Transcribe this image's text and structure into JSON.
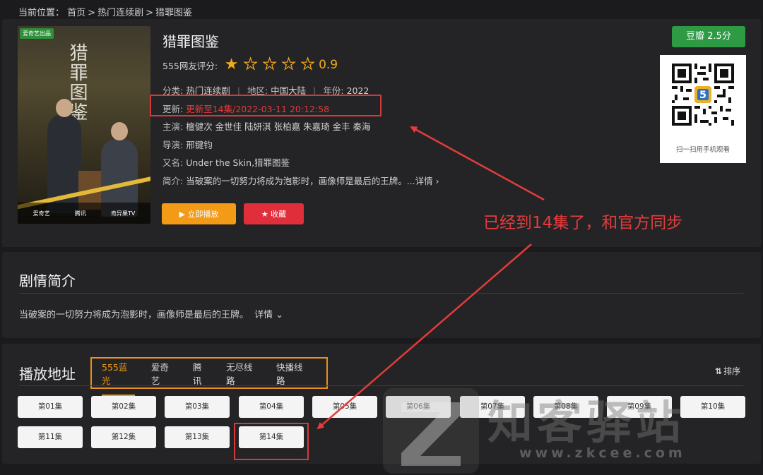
{
  "breadcrumb": {
    "prefix": "当前位置：",
    "home": "首页",
    "category": "热门连续剧",
    "current": "猎罪图鉴",
    "sep": ">"
  },
  "poster": {
    "badge": "爱奇艺出品",
    "art_title": "猎罪图鉴",
    "logos": [
      "爱奇艺",
      "腾讯",
      "奇异果TV"
    ]
  },
  "show": {
    "title": "猎罪图鉴",
    "rating_label": "555网友评分:",
    "rating_value": "0.9",
    "rating_stars": 1,
    "category_label": "分类:",
    "category": "热门连续剧",
    "region_label": "地区:",
    "region": "中国大陆",
    "year_label": "年份:",
    "year": "2022",
    "update_label": "更新:",
    "update": "更新至14集/2022-03-11 20:12:58",
    "cast_label": "主演:",
    "cast": "檀健次 金世佳 陆妍淇 张柏嘉 朱嘉琦 金丰 秦海",
    "director_label": "导演:",
    "director": "邢键钧",
    "alias_label": "又名:",
    "alias": "Under the Skin,猎罪图鉴",
    "intro_label": "简介:",
    "intro": "当破案的一切努力将成为泡影时，画像师是最后的王牌。...",
    "intro_more": "详情 ›"
  },
  "buttons": {
    "play": "▶ 立即播放",
    "fav": "★ 收藏"
  },
  "douban": "豆瓣 2.5分",
  "qr_caption": "扫一扫用手机观看",
  "annotation": "已经到14集了，和官方同步",
  "synopsis": {
    "title": "剧情简介",
    "text": "当破案的一切努力将成为泡影时，画像师是最后的王牌。",
    "more": "详情 ⌄"
  },
  "play": {
    "title": "播放地址",
    "sources": [
      "555蓝光",
      "爱奇艺",
      "腾讯",
      "无尽线路",
      "快播线路"
    ],
    "active_source": 0,
    "sort_label": "排序",
    "episodes": [
      "第01集",
      "第02集",
      "第03集",
      "第04集",
      "第05集",
      "第06集",
      "第07集",
      "第08集",
      "第09集",
      "第10集",
      "第11集",
      "第12集",
      "第13集",
      "第14集"
    ]
  },
  "watermark": {
    "brand": "知客驿站",
    "url": "www.zkcee.com"
  },
  "colors": {
    "accent": "#f39a16",
    "danger": "#e02f3b",
    "douban": "#2e9a43",
    "annotation": "#e53b3b",
    "bg": "#1b1b1d",
    "panel": "#242426"
  }
}
